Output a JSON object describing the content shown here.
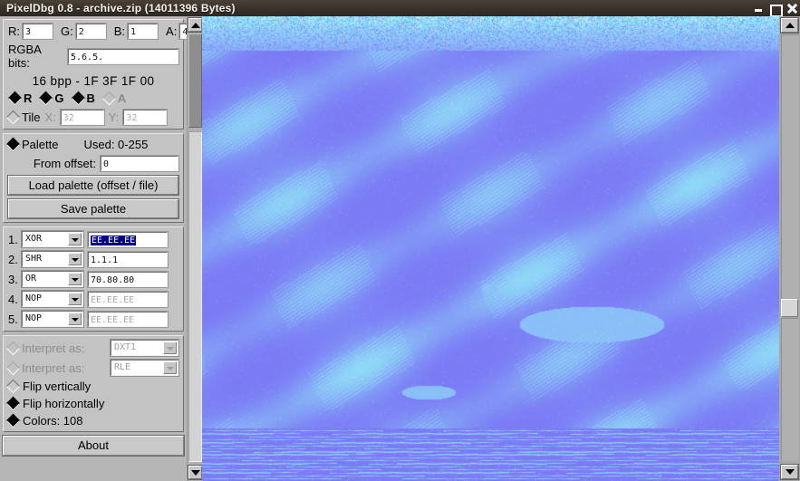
{
  "window": {
    "title": "PixelDbg 0.8  -  archive.zip (14011396 Bytes)",
    "controls": {
      "minimize": "minimize-icon",
      "maximize": "maximize-icon",
      "close": "close-icon"
    }
  },
  "format": {
    "r_label": "R:",
    "r_value": "3",
    "g_label": "G:",
    "g_value": "2",
    "b_label": "B:",
    "b_value": "1",
    "a_label": "A:",
    "a_value": "4",
    "bits_label": "RGBA bits:",
    "bits_value": "5.6.5.",
    "bpp_line": "16 bpp - 1F 3F 1F 00",
    "channels": [
      {
        "label": "R",
        "checked": true
      },
      {
        "label": "G",
        "checked": true
      },
      {
        "label": "B",
        "checked": true
      },
      {
        "label": "A",
        "checked": false,
        "disabled": true
      }
    ],
    "tile_label": "Tile",
    "tile_checked": false,
    "tile_x_label": "X:",
    "tile_x_value": "32",
    "tile_y_label": "Y:",
    "tile_y_value": "32"
  },
  "palette": {
    "label": "Palette",
    "checked": true,
    "used": "Used: 0-255",
    "offset_label": "From offset:",
    "offset_value": "0",
    "load_button": "Load palette (offset / file)",
    "save_button": "Save palette"
  },
  "operations": [
    {
      "num": "1.",
      "op": "XOR",
      "value": "EE.EE.EE",
      "selected": true,
      "disabled": false
    },
    {
      "num": "2.",
      "op": "SHR",
      "value": "1.1.1",
      "selected": false,
      "disabled": false
    },
    {
      "num": "3.",
      "op": "OR",
      "value": "70.80.80",
      "selected": false,
      "disabled": false
    },
    {
      "num": "4.",
      "op": "NOP",
      "value": "EE.EE.EE",
      "selected": false,
      "disabled": true
    },
    {
      "num": "5.",
      "op": "NOP",
      "value": "EE.EE.EE",
      "selected": false,
      "disabled": true
    }
  ],
  "decode": {
    "interpret1_label": "Interpret as:",
    "interpret1_value": "DXT1",
    "interpret1_checked": false,
    "interpret1_disabled": true,
    "interpret2_label": "Interpret as:",
    "interpret2_value": "RLE",
    "interpret2_checked": false,
    "interpret2_disabled": true,
    "flip_v_label": "Flip vertically",
    "flip_v_checked": false,
    "flip_h_label": "Flip horizontally",
    "flip_h_checked": true,
    "colors_label": "Colors: 108",
    "colors_checked": true
  },
  "about_button": "About",
  "image": {
    "base_color": "#7b7bf5",
    "streak_color": "#8fd8f7",
    "noise_top_color": "#77e6f9",
    "noise_band_height": 38,
    "bottom_band_start": 455
  }
}
